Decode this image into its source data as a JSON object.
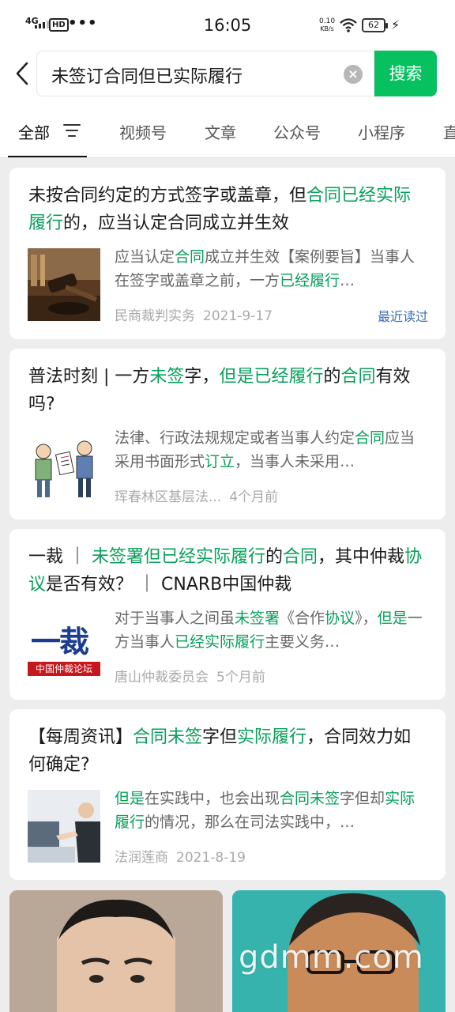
{
  "status_bar": {
    "network": "4G",
    "hd": "HD",
    "dots": "•••",
    "time": "16:05",
    "speed_value": "0.10",
    "speed_unit": "KB/s",
    "battery": "62"
  },
  "search": {
    "query": "未签订合同但已实际履行",
    "button_label": "搜索"
  },
  "tabs": [
    "全部",
    "视频号",
    "文章",
    "公众号",
    "小程序",
    "直"
  ],
  "results": [
    {
      "title_parts": [
        {
          "t": "未按合同约定的方式签字或盖章，但",
          "h": false
        },
        {
          "t": "合同已经实际履行",
          "h": true
        },
        {
          "t": "的，应当认定合同成立并生效",
          "h": false
        }
      ],
      "snippet_parts": [
        {
          "t": "应当认定",
          "h": false
        },
        {
          "t": "合同",
          "h": true
        },
        {
          "t": "成立并生效【案例要旨】当事人在签字或盖章之前，一方",
          "h": false
        },
        {
          "t": "已经履行",
          "h": true
        },
        {
          "t": "…",
          "h": false
        }
      ],
      "source": "民商裁判实务",
      "date": "2021-9-17",
      "badge": "最近读过"
    },
    {
      "title_parts": [
        {
          "t": "普法时刻 | 一方",
          "h": false
        },
        {
          "t": "未签",
          "h": true
        },
        {
          "t": "字，",
          "h": false
        },
        {
          "t": "但是已经履行",
          "h": true
        },
        {
          "t": "的",
          "h": false
        },
        {
          "t": "合同",
          "h": true
        },
        {
          "t": "有效吗?",
          "h": false
        }
      ],
      "snippet_parts": [
        {
          "t": "法律、行政法规规定或者当事人约定",
          "h": false
        },
        {
          "t": "合同",
          "h": true
        },
        {
          "t": "应当采用书面形式",
          "h": false
        },
        {
          "t": "订立",
          "h": true
        },
        {
          "t": "，当事人未采用…",
          "h": false
        }
      ],
      "source": "珲春林区基层法...",
      "date": "4个月前"
    },
    {
      "title_parts": [
        {
          "t": "一裁 ｜ ",
          "h": false
        },
        {
          "t": "未签署但已经实际履行",
          "h": true
        },
        {
          "t": "的",
          "h": false
        },
        {
          "t": "合同",
          "h": true
        },
        {
          "t": "，其中仲裁",
          "h": false
        },
        {
          "t": "协议",
          "h": true
        },
        {
          "t": "是否有效？ ｜ CNARB中国仲裁",
          "h": false
        }
      ],
      "snippet_parts": [
        {
          "t": "对于当事人之间虽",
          "h": false
        },
        {
          "t": "未签署",
          "h": true
        },
        {
          "t": "《合作",
          "h": false
        },
        {
          "t": "协议",
          "h": true
        },
        {
          "t": "》，",
          "h": false
        },
        {
          "t": "但是",
          "h": true
        },
        {
          "t": "一方当事人",
          "h": false
        },
        {
          "t": "已经实际履行",
          "h": true
        },
        {
          "t": "主要义务…",
          "h": false
        }
      ],
      "source": "唐山仲裁委员会",
      "date": "5个月前",
      "logo_text": "一裁",
      "logo_sub": "中国仲裁论坛"
    },
    {
      "title_parts": [
        {
          "t": "【每周资讯】",
          "h": false
        },
        {
          "t": "合同未签",
          "h": true
        },
        {
          "t": "字但",
          "h": false
        },
        {
          "t": "实际履行",
          "h": true
        },
        {
          "t": "，合同效力如何确定?",
          "h": false
        }
      ],
      "snippet_parts": [
        {
          "t": "但是",
          "h": true
        },
        {
          "t": "在实践中，也会出现",
          "h": false
        },
        {
          "t": "合同未签",
          "h": true
        },
        {
          "t": "字但却",
          "h": false
        },
        {
          "t": "实际履行",
          "h": true
        },
        {
          "t": "的情况，那么在司法实践中，…",
          "h": false
        }
      ],
      "source": "法润莲商",
      "date": "2021-8-19"
    }
  ],
  "watermark": "gdmm.com"
}
